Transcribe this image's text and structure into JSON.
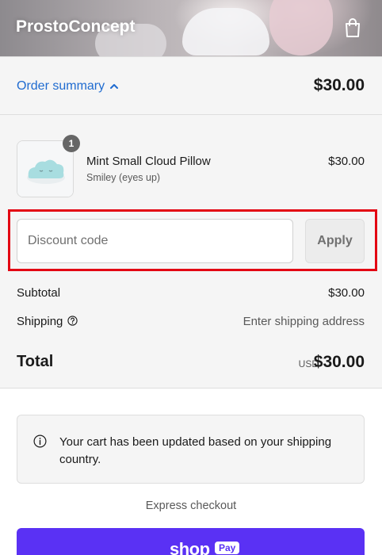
{
  "header": {
    "brand": "ProstoConcept",
    "cart_icon": "shopping-bag-icon"
  },
  "summary_toggle": {
    "label": "Order summary",
    "chevron_icon": "chevron-up-icon",
    "total": "$30.00"
  },
  "cart": {
    "items": [
      {
        "quantity": "1",
        "name": "Mint Small Cloud Pillow",
        "variant": "Smiley (eyes up)",
        "price": "$30.00",
        "thumbnail_icon": "cloud-pillow-image"
      }
    ]
  },
  "discount": {
    "placeholder": "Discount code",
    "value": "",
    "apply_label": "Apply",
    "highlight_color": "#e30613"
  },
  "totals": {
    "subtotal_label": "Subtotal",
    "subtotal_value": "$30.00",
    "shipping_label": "Shipping",
    "shipping_help_icon": "help-circle-icon",
    "shipping_value": "Enter shipping address",
    "total_label": "Total",
    "total_currency": "USD",
    "total_value": "$30.00"
  },
  "notice": {
    "icon": "info-icon",
    "text": "Your cart has been updated based on your shipping country."
  },
  "express": {
    "label": "Express checkout",
    "shop_pay_brand": "shop",
    "shop_pay_badge": "Pay",
    "shop_pay_color": "#5a31f4"
  },
  "colors": {
    "link": "#1f6bd0",
    "panel_bg": "#f5f5f5"
  }
}
